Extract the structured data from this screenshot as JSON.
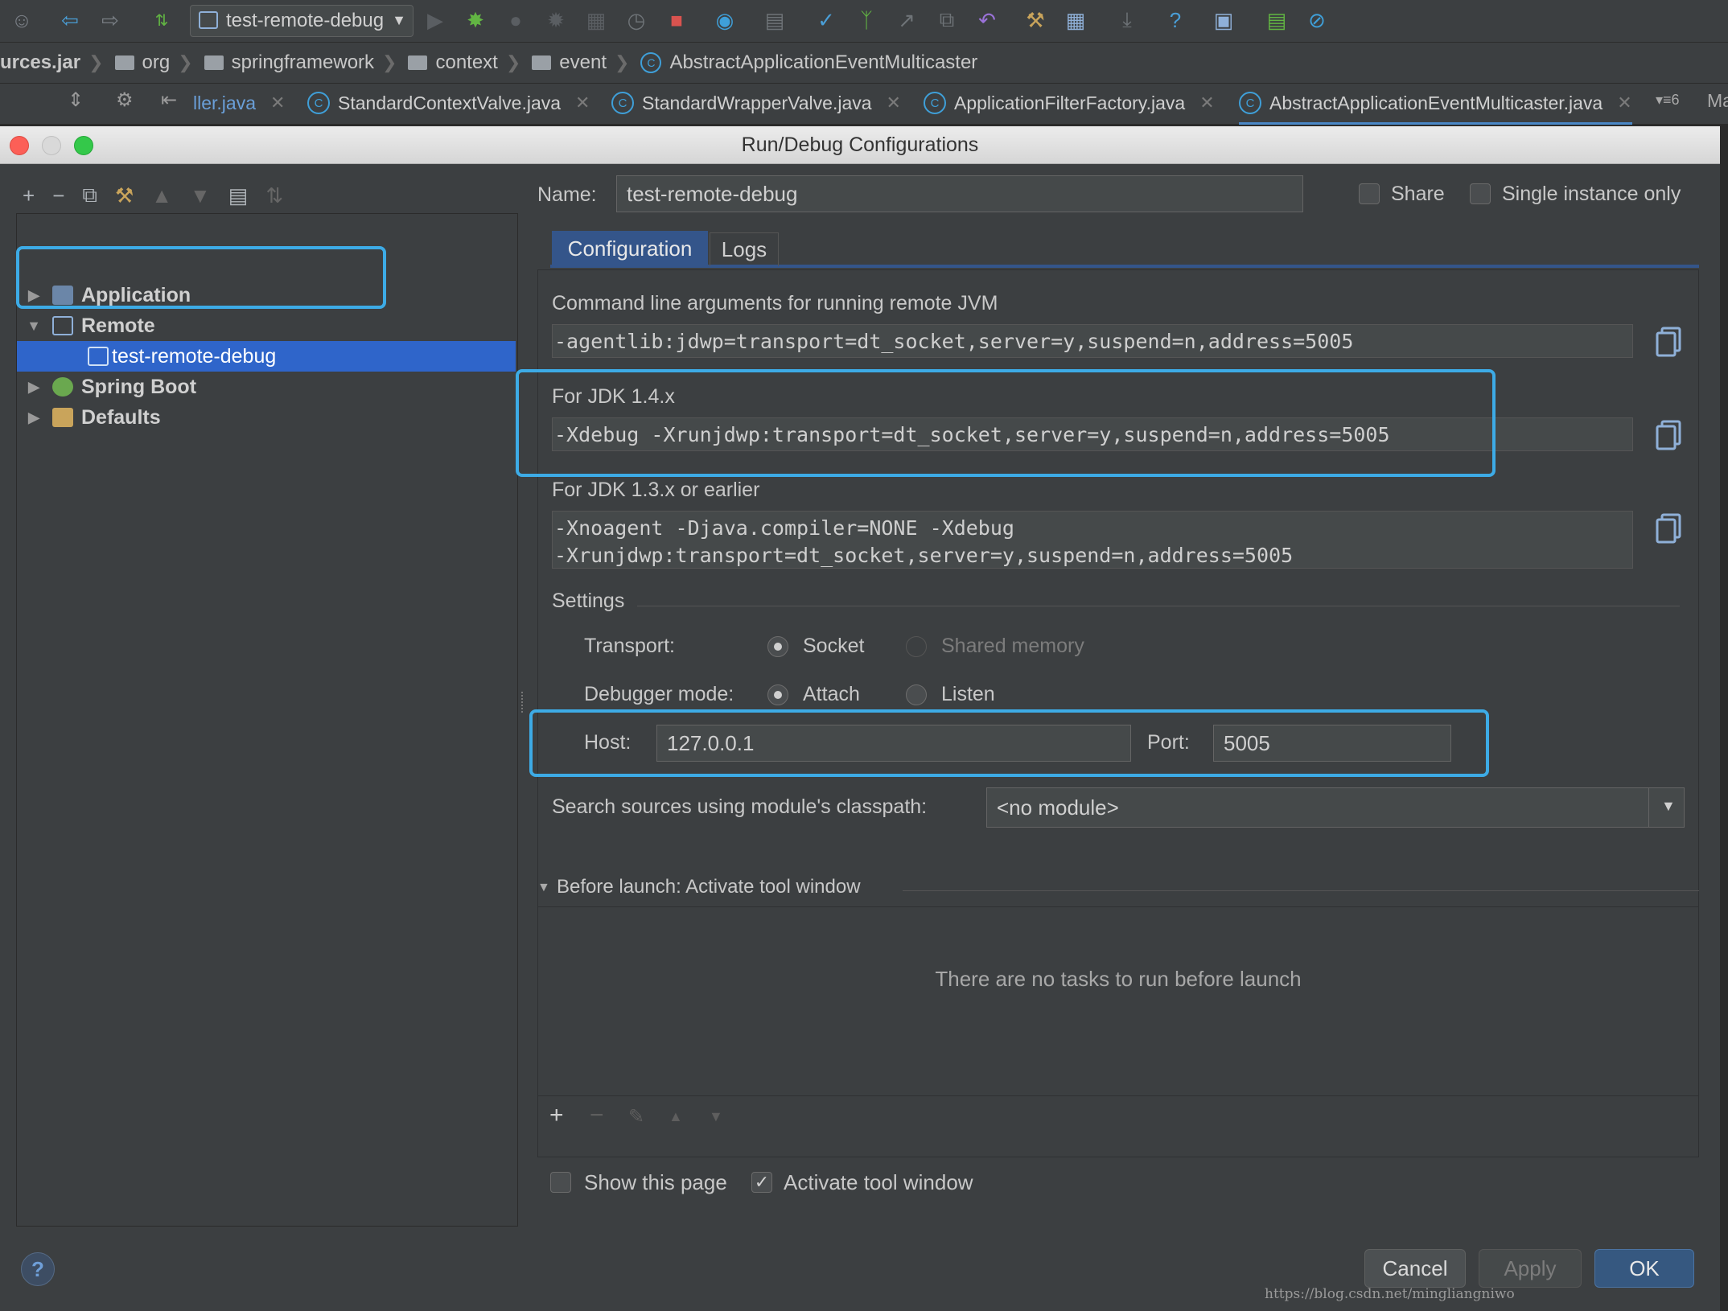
{
  "toolbar": {
    "run_config": "test-remote-debug"
  },
  "breadcrumbs": [
    {
      "label": "urces.jar",
      "folder": false
    },
    {
      "label": "org",
      "folder": true
    },
    {
      "label": "springframework",
      "folder": true
    },
    {
      "label": "context",
      "folder": true
    },
    {
      "label": "event",
      "folder": true
    },
    {
      "label": "AbstractApplicationEventMulticaster",
      "folder": false,
      "class": true
    }
  ],
  "editor_tabs": [
    {
      "label": "ller.java"
    },
    {
      "label": "StandardContextValve.java"
    },
    {
      "label": "StandardWrapperValve.java"
    },
    {
      "label": "ApplicationFilterFactory.java"
    },
    {
      "label": "AbstractApplicationEventMulticaster.java"
    }
  ],
  "editor_tabs_overflow": "6",
  "editor_tabs_cut": "Ma",
  "dialog": {
    "title": "Run/Debug Configurations"
  },
  "tree": {
    "items": [
      {
        "label": "Application"
      },
      {
        "label": "Remote"
      },
      {
        "label": "test-remote-debug"
      },
      {
        "label": "Spring Boot"
      },
      {
        "label": "Defaults"
      }
    ]
  },
  "form": {
    "name_label": "Name:",
    "name_value": "test-remote-debug",
    "share_label": "Share",
    "single_instance_label": "Single instance only",
    "tab_configuration": "Configuration",
    "tab_logs": "Logs",
    "cmd_title": "Command line arguments for running remote JVM",
    "cmd_value": "-agentlib:jdwp=transport=dt_socket,server=y,suspend=n,address=5005",
    "jdk14_title": "For JDK 1.4.x",
    "jdk14_value": "-Xdebug -Xrunjdwp:transport=dt_socket,server=y,suspend=n,address=5005",
    "jdk13_title": "For JDK 1.3.x or earlier",
    "jdk13_line1": "-Xnoagent -Djava.compiler=NONE -Xdebug",
    "jdk13_line2": "-Xrunjdwp:transport=dt_socket,server=y,suspend=n,address=5005",
    "settings_title": "Settings",
    "transport_label": "Transport:",
    "transport_socket": "Socket",
    "transport_shared": "Shared memory",
    "debugger_label": "Debugger mode:",
    "debugger_attach": "Attach",
    "debugger_listen": "Listen",
    "host_label": "Host:",
    "host_value": "127.0.0.1",
    "port_label": "Port:",
    "port_value": "5005",
    "classpath_label": "Search sources using module's classpath:",
    "classpath_value": "<no module>",
    "before_launch_title": "Before launch: Activate tool window",
    "before_launch_empty": "There are no tasks to run before launch",
    "show_page_label": "Show this page",
    "activate_label": "Activate tool window"
  },
  "buttons": {
    "cancel": "Cancel",
    "apply": "Apply",
    "ok": "OK"
  },
  "help_glyph": "?",
  "watermark": "https://blog.csdn.net/mingliangniwo",
  "colors": {
    "accent_blue": "#2f65ca",
    "highlight_box": "#3dabe6",
    "background": "#3c3f41"
  }
}
